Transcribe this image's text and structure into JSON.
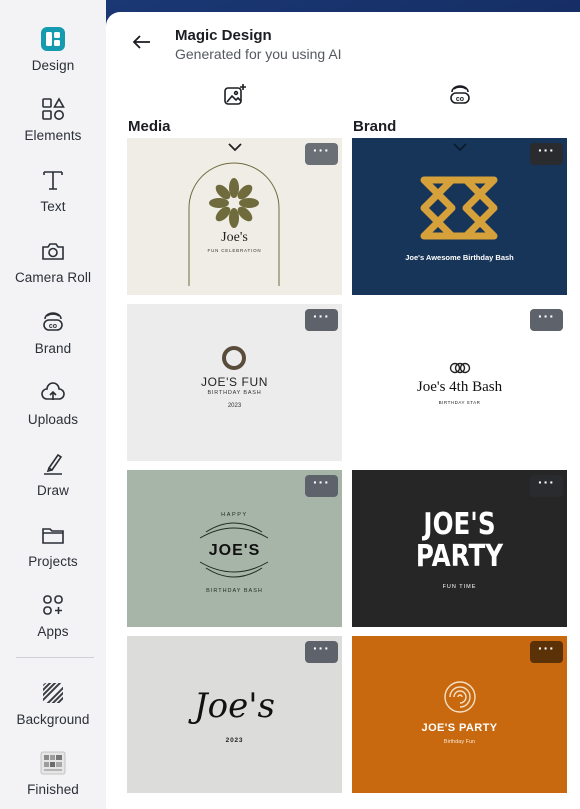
{
  "sidebar": {
    "items": [
      {
        "label": "Design",
        "icon": "design-icon"
      },
      {
        "label": "Elements",
        "icon": "elements-icon"
      },
      {
        "label": "Text",
        "icon": "text-icon"
      },
      {
        "label": "Camera Roll",
        "icon": "camera-icon"
      },
      {
        "label": "Brand",
        "icon": "brand-icon"
      },
      {
        "label": "Uploads",
        "icon": "uploads-icon"
      },
      {
        "label": "Draw",
        "icon": "draw-icon"
      },
      {
        "label": "Projects",
        "icon": "folder-icon"
      },
      {
        "label": "Apps",
        "icon": "apps-icon"
      },
      {
        "label": "Background",
        "icon": "background-icon"
      },
      {
        "label": "Finished",
        "icon": "finished-thumbnail"
      }
    ]
  },
  "header": {
    "title": "Magic Design",
    "subtitle": "Generated for you using AI"
  },
  "columns": {
    "media_label": "Media",
    "brand_label": "Brand"
  },
  "more_label": "···",
  "cards": {
    "c1": {
      "name": "Joe's",
      "tagline": "FUN CELEBRATION",
      "bg": "#efede6"
    },
    "c2": {
      "name": "Joe's Awesome Birthday Bash",
      "bg": "#173558"
    },
    "c3": {
      "name": "JOE'S FUN",
      "tagline": "BIRTHDAY BASH",
      "year": "2023",
      "bg": "#ececec"
    },
    "c4": {
      "name": "Joe's 4th Bash",
      "tagline": "BIRTHDAY STAR",
      "bg": "#ffffff"
    },
    "c5": {
      "top": "HAPPY",
      "name": "JOE'S",
      "tagline": "BIRTHDAY BASH",
      "bg": "#a7b5a8"
    },
    "c6": {
      "line1": "JOE'S",
      "line2": "PARTY",
      "tagline": "FUN TIME",
      "bg": "#262626"
    },
    "c7": {
      "name": "Joe's",
      "year": "2023",
      "bg": "#dcdcda"
    },
    "c8": {
      "name": "JOE'S PARTY",
      "tagline": "Birthday Fun",
      "bg": "#c8690f"
    }
  },
  "colors": {
    "accent_teal": "#159bb0",
    "gold": "#d6a13a",
    "olive": "#6f6b3d"
  }
}
